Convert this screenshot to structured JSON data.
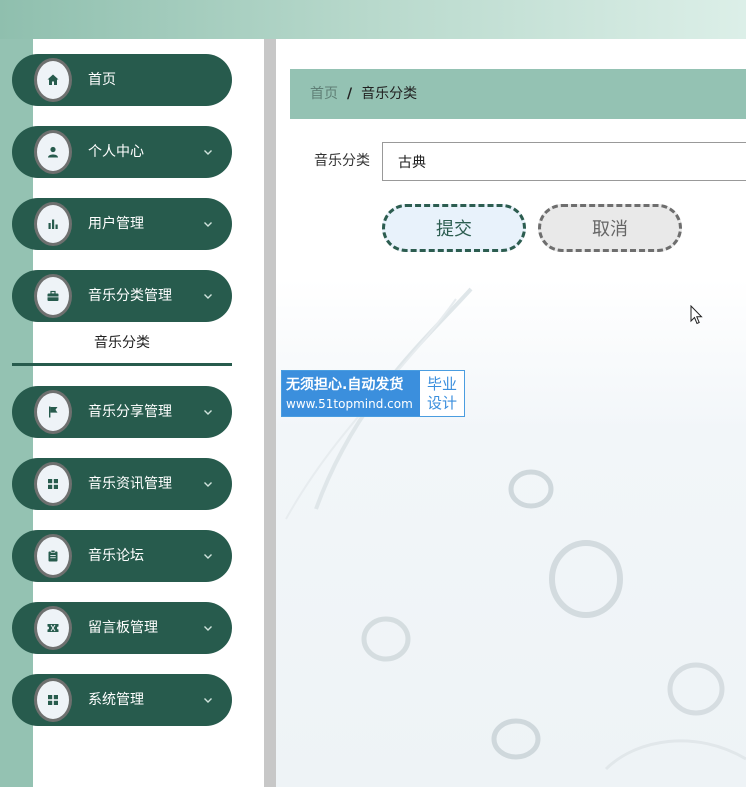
{
  "sidebar": {
    "items": [
      {
        "label": "首页",
        "icon": "home-icon",
        "has_submenu": false
      },
      {
        "label": "个人中心",
        "icon": "user-icon",
        "has_submenu": true
      },
      {
        "label": "用户管理",
        "icon": "bar-chart-icon",
        "has_submenu": true
      },
      {
        "label": "音乐分类管理",
        "icon": "briefcase-icon",
        "has_submenu": true,
        "expanded": true
      },
      {
        "label": "音乐分享管理",
        "icon": "flag-icon",
        "has_submenu": true
      },
      {
        "label": "音乐资讯管理",
        "icon": "grid-icon",
        "has_submenu": true
      },
      {
        "label": "音乐论坛",
        "icon": "clipboard-icon",
        "has_submenu": true
      },
      {
        "label": "留言板管理",
        "icon": "ticket-icon",
        "has_submenu": true
      },
      {
        "label": "系统管理",
        "icon": "grid-icon",
        "has_submenu": true
      }
    ],
    "subitem": {
      "label": "音乐分类"
    }
  },
  "breadcrumb": {
    "home": "首页",
    "separator": "/",
    "current": "音乐分类"
  },
  "form": {
    "label": "音乐分类",
    "value": "古典",
    "submit_label": "提交",
    "cancel_label": "取消"
  },
  "watermark": {
    "line1": "无须担心.自动发货",
    "line2": "www.51topmind.com",
    "right1": "毕业",
    "right2": "设计"
  },
  "colors": {
    "primary": "#275b4d",
    "accent": "#94c2b3",
    "topbar_start": "#8fbfae",
    "watermark_blue": "#3b8fdd"
  }
}
